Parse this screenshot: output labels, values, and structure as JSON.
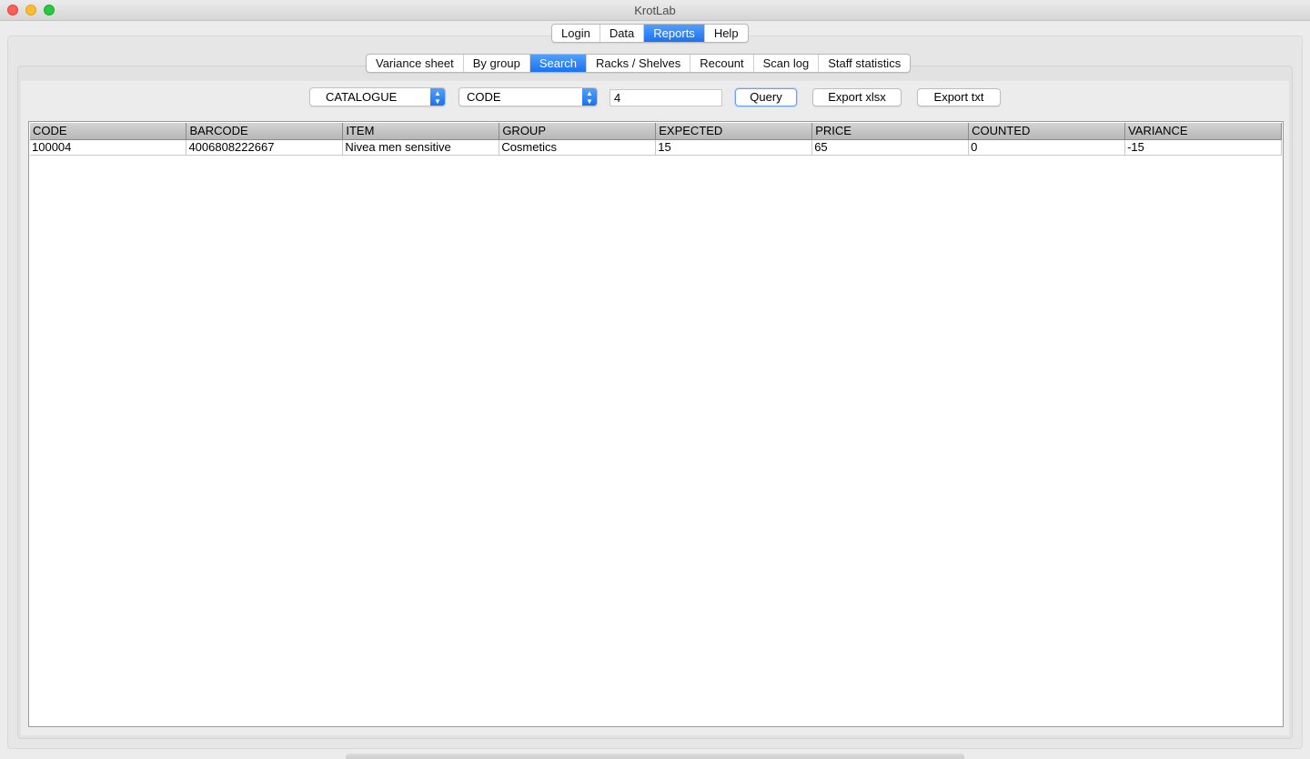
{
  "window": {
    "title": "KrotLab"
  },
  "main_tabs": [
    {
      "label": "Login",
      "active": false
    },
    {
      "label": "Data",
      "active": false
    },
    {
      "label": "Reports",
      "active": true
    },
    {
      "label": "Help",
      "active": false
    }
  ],
  "sub_tabs": [
    {
      "label": "Variance sheet",
      "active": false
    },
    {
      "label": "By group",
      "active": false
    },
    {
      "label": "Search",
      "active": true
    },
    {
      "label": "Racks / Shelves",
      "active": false
    },
    {
      "label": "Recount",
      "active": false
    },
    {
      "label": "Scan log",
      "active": false
    },
    {
      "label": "Staff statistics",
      "active": false
    }
  ],
  "controls": {
    "source_select": "CATALOGUE",
    "field_select": "CODE",
    "search_value": "4",
    "query_label": "Query",
    "export_xlsx_label": "Export xlsx",
    "export_txt_label": "Export txt"
  },
  "table": {
    "columns": [
      "CODE",
      "BARCODE",
      "ITEM",
      "GROUP",
      "EXPECTED",
      "PRICE",
      "COUNTED",
      "VARIANCE"
    ],
    "rows": [
      [
        "100004",
        "4006808222667",
        "Nivea men sensitive",
        "Cosmetics",
        "15",
        "65",
        "0",
        "-15"
      ]
    ]
  },
  "colors": {
    "accent": "#1a72f0",
    "window_bg": "#ececec"
  }
}
